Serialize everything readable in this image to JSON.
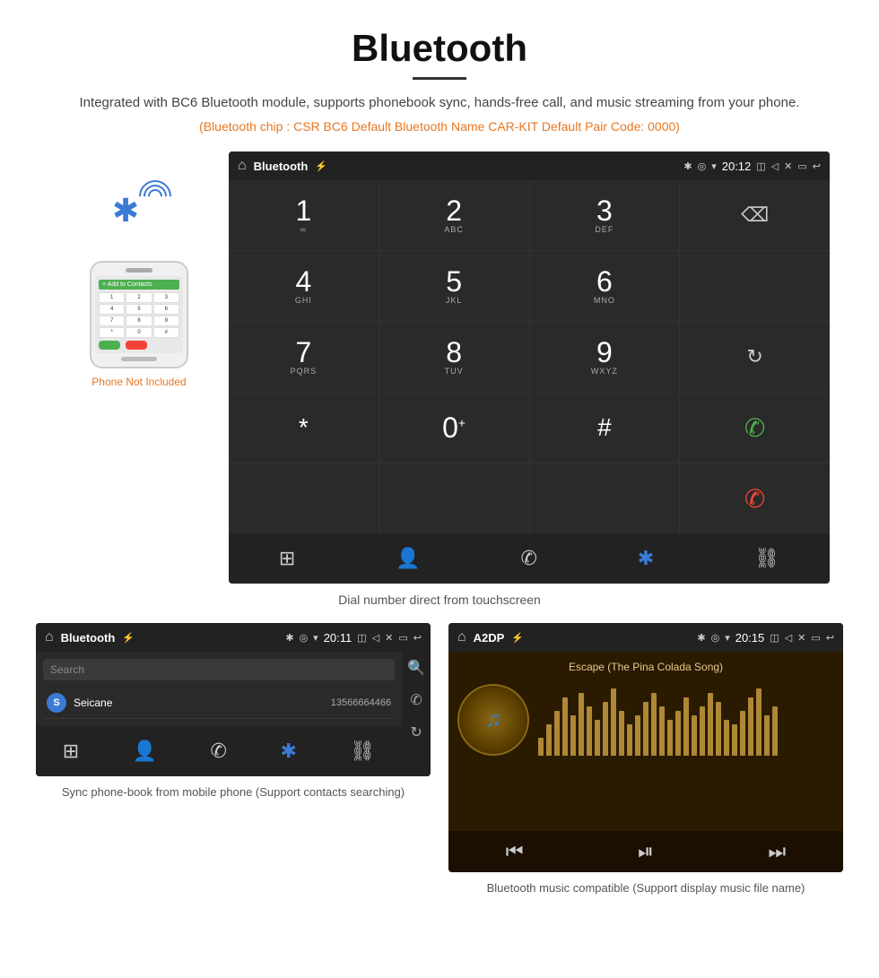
{
  "page": {
    "title": "Bluetooth",
    "description": "Integrated with BC6 Bluetooth module, supports phonebook sync, hands-free call, and music streaming from your phone.",
    "specs": "(Bluetooth chip : CSR BC6    Default Bluetooth Name CAR-KIT    Default Pair Code: 0000)",
    "dial_caption": "Dial number direct from touchscreen",
    "phonebook_caption": "Sync phone-book from mobile phone\n(Support contacts searching)",
    "music_caption": "Bluetooth music compatible\n(Support display music file name)",
    "phone_not_included": "Phone Not Included"
  },
  "dial_screen": {
    "app_name": "Bluetooth",
    "time": "20:12",
    "keys": [
      {
        "number": "1",
        "letters": "∞",
        "symbol": false
      },
      {
        "number": "2",
        "letters": "ABC",
        "symbol": false
      },
      {
        "number": "3",
        "letters": "DEF",
        "symbol": false
      },
      {
        "number": "",
        "letters": "",
        "symbol": false,
        "special": "backspace"
      },
      {
        "number": "4",
        "letters": "GHI",
        "symbol": false
      },
      {
        "number": "5",
        "letters": "JKL",
        "symbol": false
      },
      {
        "number": "6",
        "letters": "MNO",
        "symbol": false
      },
      {
        "number": "",
        "letters": "",
        "symbol": false,
        "special": "empty"
      },
      {
        "number": "7",
        "letters": "PQRS",
        "symbol": false
      },
      {
        "number": "8",
        "letters": "TUV",
        "symbol": false
      },
      {
        "number": "9",
        "letters": "WXYZ",
        "symbol": false
      },
      {
        "number": "",
        "letters": "",
        "symbol": false,
        "special": "refresh"
      },
      {
        "number": "*",
        "letters": "",
        "symbol": true
      },
      {
        "number": "0",
        "letters": "+",
        "symbol": false
      },
      {
        "number": "#",
        "letters": "",
        "symbol": true
      },
      {
        "number": "",
        "letters": "",
        "symbol": false,
        "special": "call-green"
      },
      {
        "number": "",
        "letters": "",
        "symbol": false,
        "special": "empty"
      },
      {
        "number": "",
        "letters": "",
        "symbol": false,
        "special": "empty"
      },
      {
        "number": "",
        "letters": "",
        "symbol": false,
        "special": "empty"
      },
      {
        "number": "",
        "letters": "",
        "symbol": false,
        "special": "call-red"
      }
    ]
  },
  "phonebook_screen": {
    "app_name": "Bluetooth",
    "time": "20:11",
    "search_placeholder": "Search",
    "contact_name": "Seicane",
    "contact_number": "13566664466"
  },
  "music_screen": {
    "app_name": "A2DP",
    "time": "20:15",
    "song_title": "Escape (The Pina Colada Song)"
  },
  "eq_bars": [
    20,
    35,
    50,
    65,
    45,
    70,
    55,
    40,
    60,
    75,
    50,
    35,
    45,
    60,
    70,
    55,
    40,
    50,
    65,
    45,
    55,
    70,
    60,
    40,
    35,
    50,
    65,
    75,
    45,
    55
  ]
}
